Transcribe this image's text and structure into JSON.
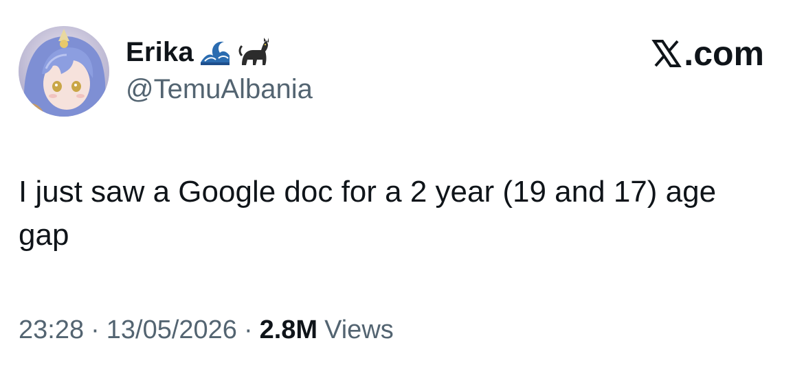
{
  "author": {
    "display_name": "Erika",
    "handle": "@TemuAlbania",
    "name_emojis": [
      "wave-emoji",
      "black-cat-emoji"
    ]
  },
  "brand": {
    "logo": "x-logo-icon",
    "label": ".com"
  },
  "tweet": {
    "text": "I just saw a Google doc for a 2 year (19 and 17) age gap"
  },
  "meta": {
    "time": "23:28",
    "separator": "·",
    "date": "13/05/2026",
    "views_count": "2.8M",
    "views_label": "Views"
  },
  "colors": {
    "text_primary": "#0f1419",
    "text_secondary": "#536471",
    "background": "#ffffff"
  }
}
